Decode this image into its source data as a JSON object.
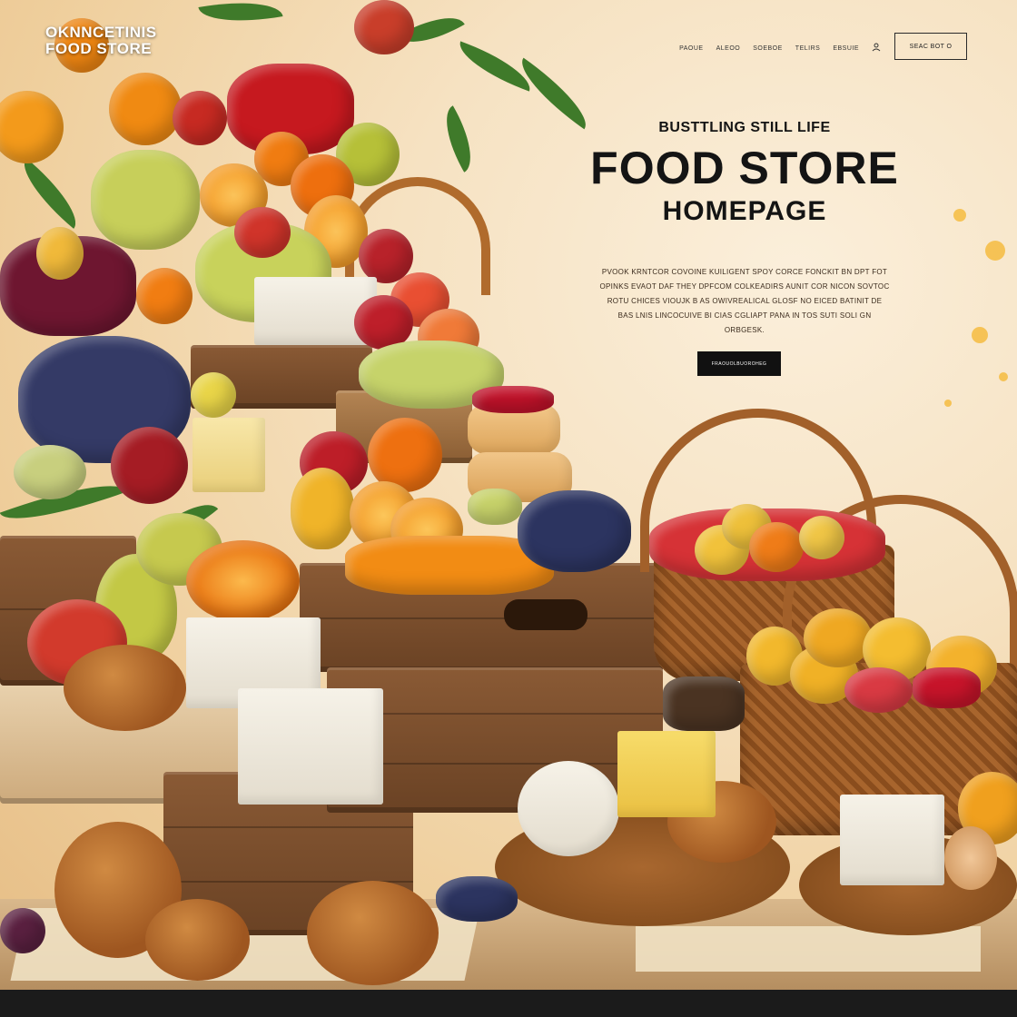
{
  "header": {
    "logo_line1": "OKNNCETINIS",
    "logo_line2": "FOOD STORE",
    "nav": [
      "PAOUE",
      "ALEOO",
      "SOEBOE",
      "TELIRS",
      "EBSUIE"
    ],
    "user_icon": "user-icon",
    "button_label": "SEAC BOT O"
  },
  "hero": {
    "eyebrow": "BUSTTLING STILL LIFE",
    "title": "FOOD STORE",
    "subtitle": "HOMEPAGE",
    "description": "PVOOK KRNTCOR COVOINE KUILIGENT SPOY CORCE FONCKIT BN DPT FOT OPINKS EVAOT DAF THEY DPFCOM COLKEADIRS AUNIT COR NICON SOVTOC ROTU CHICES VIOUJK B AS OWIVREALICAL GLOSF NO EICED BATINIT DE BAS LNIS LINCOCUIVE BI CIAS CGLIAPT PANA IN TOS SUTI SOLI GN ORBGESK.",
    "cta_label": "FRAOUOLBUOROHEG"
  },
  "colors": {
    "accent": "#111111",
    "wall": "#f6e2c2",
    "text": "#141414"
  }
}
